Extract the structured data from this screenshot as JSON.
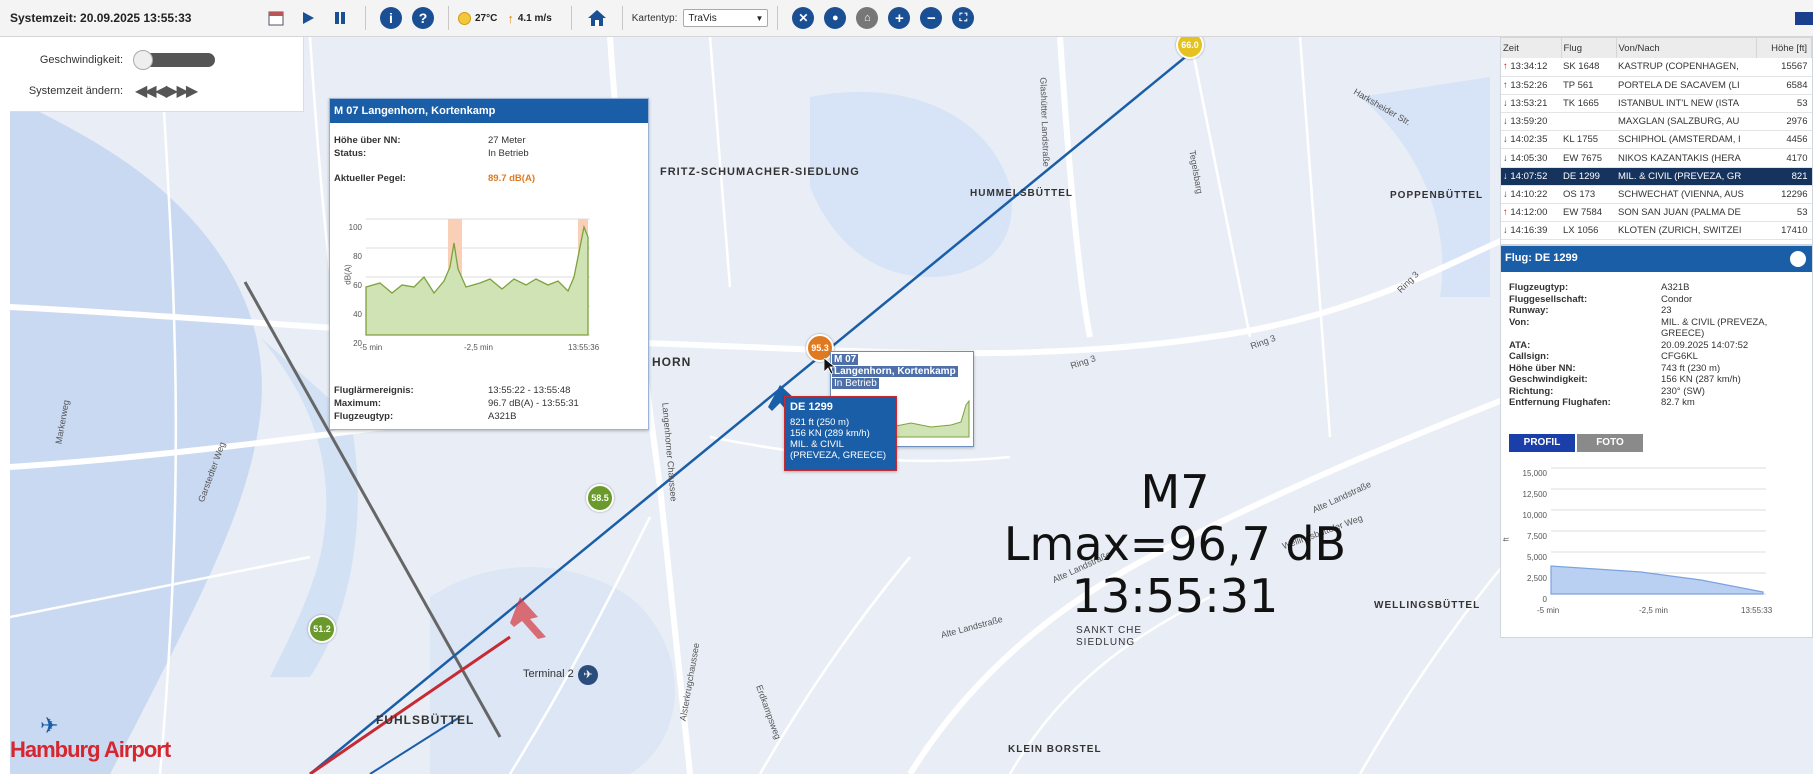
{
  "toolbar": {
    "system_time": "Systemzeit: 20.09.2025 13:55:33",
    "temperature": "27°C",
    "wind": "4.1 m/s",
    "map_type_label": "Kartentyp:",
    "map_type_value": "TraVis"
  },
  "controls": {
    "speed_label": "Geschwindigkeit:",
    "time_label": "Systemzeit ändern:"
  },
  "station_popup": {
    "title": "M 07 Langenhorn, Kortenkamp",
    "height_label": "Höhe über NN:",
    "height_value": "27 Meter",
    "status_label": "Status:",
    "status_value": "In Betrieb",
    "level_label": "Aktueller Pegel:",
    "level_value": "89.7 dB(A)",
    "chart_ylabel": "dB(A)",
    "chart_y_ticks": [
      "100",
      "80",
      "60",
      "40",
      "20"
    ],
    "chart_x_ticks": [
      "-5 min",
      "-2,5 min",
      "13:55:36"
    ],
    "event_label": "Fluglärmereignis:",
    "event_value": "13:55:22 - 13:55:48",
    "max_label": "Maximum:",
    "max_value": "96.7 dB(A) - 13:55:31",
    "aircraft_label": "Flugzeugtyp:",
    "aircraft_value": "A321B"
  },
  "mini_station": {
    "title": "M 07",
    "subtitle": "Langenhorn, Kortenkamp",
    "status": "In Betrieb"
  },
  "flight_tooltip": {
    "title": "DE 1299",
    "line1": "821 ft (250 m)",
    "line2": "156 KN (289 km/h)",
    "line3": "MIL. & CIVIL",
    "line4": "(PREVEZA, GREECE)"
  },
  "flight_list": {
    "headers": [
      "Zeit",
      "Flug",
      "Von/Nach",
      "Höhe [ft]"
    ],
    "rows": [
      {
        "dir": "up",
        "time": "13:34:12",
        "flight": "SK 1648",
        "route": "KASTRUP (COPENHAGEN,",
        "alt": "15567"
      },
      {
        "dir": "up",
        "time": "13:52:26",
        "flight": "TP 561",
        "route": "PORTELA DE SACAVEM (LI",
        "alt": "6584"
      },
      {
        "dir": "down",
        "time": "13:53:21",
        "flight": "TK 1665",
        "route": "ISTANBUL INT'L NEW (ISTA",
        "alt": "53"
      },
      {
        "dir": "down",
        "time": "13:59:20",
        "flight": "",
        "route": "MAXGLAN (SALZBURG, AU",
        "alt": "2976"
      },
      {
        "dir": "down",
        "time": "14:02:35",
        "flight": "KL 1755",
        "route": "SCHIPHOL (AMSTERDAM, I",
        "alt": "4456"
      },
      {
        "dir": "down",
        "time": "14:05:30",
        "flight": "EW 7675",
        "route": "NIKOS KAZANTAKIS (HERA",
        "alt": "4170"
      },
      {
        "dir": "down",
        "time": "14:07:52",
        "flight": "DE 1299",
        "route": "MIL. & CIVIL (PREVEZA, GR",
        "alt": "821",
        "selected": true
      },
      {
        "dir": "down",
        "time": "14:10:22",
        "flight": "OS 173",
        "route": "SCHWECHAT (VIENNA, AUS",
        "alt": "12296"
      },
      {
        "dir": "up",
        "time": "14:12:00",
        "flight": "EW 7584",
        "route": "SON SAN JUAN (PALMA DE",
        "alt": "53"
      },
      {
        "dir": "down",
        "time": "14:16:39",
        "flight": "LX 1056",
        "route": "KLOTEN (ZURICH, SWITZEI",
        "alt": "17410"
      }
    ]
  },
  "flight_detail": {
    "title": "Flug: DE 1299",
    "fields": [
      {
        "k": "Flugzeugtyp:",
        "v": "A321B"
      },
      {
        "k": "Fluggesellschaft:",
        "v": "Condor"
      },
      {
        "k": "Runway:",
        "v": "23"
      },
      {
        "k": "Von:",
        "v": "MIL. & CIVIL (PREVEZA,"
      },
      {
        "k": "",
        "v": "GREECE)"
      },
      {
        "k": "ATA:",
        "v": "20.09.2025 14:07:52"
      },
      {
        "k": "Callsign:",
        "v": "CFG6KL"
      },
      {
        "k": "Höhe über NN:",
        "v": "743 ft (230 m)"
      },
      {
        "k": "Geschwindigkeit:",
        "v": "156 KN (287 km/h)"
      },
      {
        "k": "Richtung:",
        "v": "230° (SW)"
      },
      {
        "k": "Entfernung Flughafen:",
        "v": "82.7 km"
      }
    ],
    "tab_profile": "PROFIL",
    "tab_photo": "FOTO",
    "chart_ylabel": "ft",
    "chart_y_ticks": [
      "15,000",
      "12,500",
      "10,000",
      "7,500",
      "5,000",
      "2,500",
      "0"
    ],
    "chart_x_ticks": [
      "-5 min",
      "-2,5 min",
      "13:55:33"
    ]
  },
  "map": {
    "pins": [
      {
        "label": "66.0",
        "color": "#e5c21f"
      },
      {
        "label": "95.3",
        "color": "#e07a20"
      },
      {
        "label": "58.5",
        "color": "#6a9a2b"
      },
      {
        "label": "51.2",
        "color": "#6a9a2b"
      }
    ],
    "labels": {
      "fritz": "FRITZ-SCHUMACHER-SIEDLUNG",
      "hummels": "HUMMELSBÜTTEL",
      "poppen": "POPPENBÜTTEL",
      "horn": "HORN",
      "wellings": "WELLINGSBÜTTEL",
      "fuhls": "FUHLSBÜTTEL",
      "klein": "KLEIN BORSTEL",
      "siedlung1": "SANKT CHE",
      "siedlung2": "SIEDLUNG",
      "terminal": "Terminal 2",
      "logo": "Hamburg Airport"
    },
    "streets": {
      "ring3a": "Ring 3",
      "ring3b": "Ring 3",
      "ring3c": "Ring 3",
      "alte1": "Alte Landstraße",
      "alte2": "Alte Landstraße",
      "alte3": "Alte Landstraße",
      "langenhorner": "Langenhorner Chaussee",
      "wellingsweg": "Wellingsbütteler Weg",
      "garstedter": "Garstedter Weg",
      "tegelsbarg": "Tegelsbarg",
      "harksheider": "Harksheider Str.",
      "glashuetter": "Glashütter Landstraße",
      "markweg": "Markerweg",
      "erdkamp": "Erdkampsweg",
      "alster": "Alsterkrugchaussee"
    },
    "overlay_line1": "M7",
    "overlay_line2": "Lmax=96,7 dB",
    "overlay_line3": "13:55:31"
  }
}
